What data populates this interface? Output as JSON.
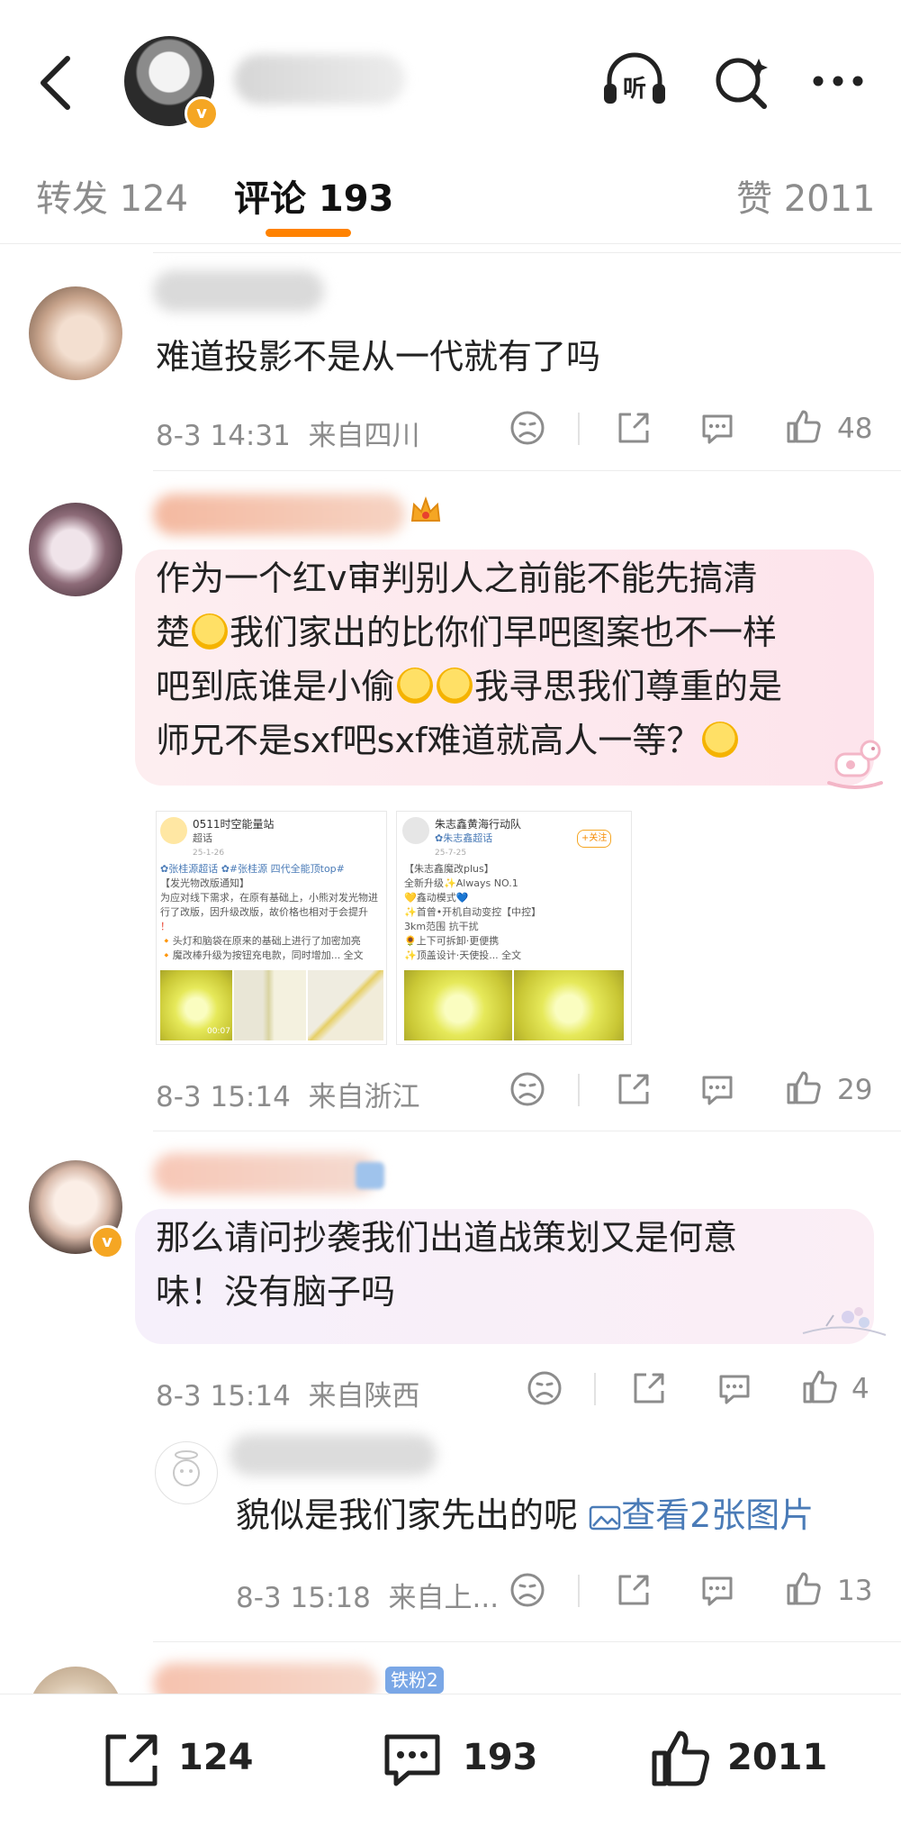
{
  "tabs": [
    {
      "label": "转发 124"
    },
    {
      "label": "评论 193"
    },
    {
      "label": "赞 2011"
    }
  ],
  "header_icons": [
    "back-icon",
    "listen-icon",
    "search-icon",
    "more-icon"
  ],
  "listen_label": "听",
  "comments": [
    {
      "text": "难道投影不是从一代就有了吗",
      "time": "8-3 14:31",
      "location": "来自四川",
      "likes": "48"
    },
    {
      "text_lines": [
        "作为一个红v审判别人之前能不能先搞清",
        "楚",
        "我们家出的比你们早吧图案也不一样",
        "吧到底谁是小偷",
        "我寻思我们尊重的是",
        "师兄不是sxf吧sxf难道就高人一等？"
      ],
      "time": "8-3 15:14",
      "location": "来自浙江",
      "likes": "29",
      "images": [
        {
          "title": "0511时空能量站",
          "subtitle": "超话",
          "date": "25-1-26",
          "tag_line": "✿张桂源超话  ✿#张桂源 四代全能顶top#",
          "lines": [
            "【发光物改版通知】",
            "为应对线下需求，在原有基础上，小熊对发光物进",
            "行了改版，因升级改版，故价格也相对于会提升",
            "！",
            "🔸头灯和脑袋在原来的基础上进行了加密加亮",
            "🔸魔改棒升级为按钮充电款，同时增加... 全文"
          ],
          "duration": "00:07"
        },
        {
          "title": "朱志鑫黄海行动队",
          "subtitle": "✿朱志鑫超话",
          "date": "25-7-25",
          "follow_label": "+关注",
          "lines": [
            "【朱志鑫魔改plus】",
            "全新升级✨Always NO.1",
            "💛鑫动模式💙",
            "✨首曾•开机自动变控【中控】",
            "3km范围 抗干扰",
            "🌻上下可拆卸·更便携",
            "✨顶盖设计·天使投... 全文"
          ]
        }
      ]
    },
    {
      "text_lines": [
        "那么请问抄袭我们出道战策划又是何意",
        "味！没有脑子吗"
      ],
      "time": "8-3 15:14",
      "location": "来自陕西",
      "likes": "4",
      "reply": {
        "text": "貌似是我们家先出的呢",
        "image_link": "查看2张图片",
        "time": "8-3 15:18",
        "location": "来自上...",
        "likes": "13"
      }
    },
    {
      "badge": "铁粉2"
    }
  ],
  "bottom_bar": {
    "repost_count": "124",
    "comment_count": "193",
    "like_count": "2011"
  },
  "colors": {
    "accent": "#ff8200",
    "text": "#222222",
    "muted": "#8c8c8c",
    "link": "#4a7bb7"
  }
}
